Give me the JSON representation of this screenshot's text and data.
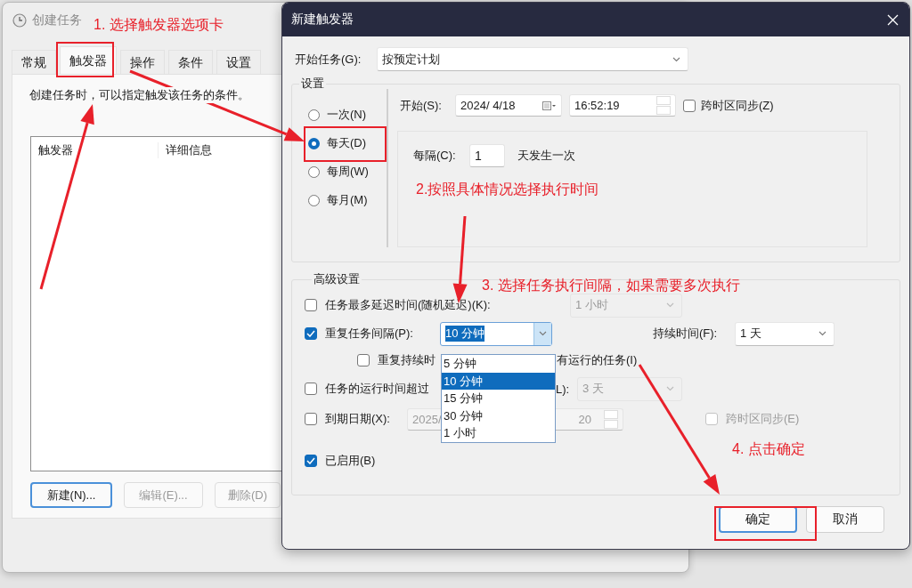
{
  "back_window": {
    "title": "创建任务",
    "tabs": [
      {
        "label": "常规",
        "selected": false
      },
      {
        "label": "触发器",
        "selected": true
      },
      {
        "label": "操作",
        "selected": false
      },
      {
        "label": "条件",
        "selected": false
      },
      {
        "label": "设置",
        "selected": false
      }
    ],
    "description": "创建任务时，可以指定触发该任务的条件。",
    "table": {
      "columns": [
        "触发器",
        "详细信息"
      ]
    },
    "buttons": [
      {
        "label": "新建(N)...",
        "disabled": false
      },
      {
        "label": "编辑(E)...",
        "disabled": true
      },
      {
        "label": "删除(D)",
        "disabled": true
      }
    ]
  },
  "dialog": {
    "title": "新建触发器",
    "begin_task": {
      "label": "开始任务(G):",
      "value": "按预定计划"
    },
    "settings": {
      "title": "设置",
      "schedule_options": [
        {
          "label": "一次(N)",
          "selected": false
        },
        {
          "label": "每天(D)",
          "selected": true
        },
        {
          "label": "每周(W)",
          "selected": false
        },
        {
          "label": "每月(M)",
          "selected": false
        }
      ],
      "start": {
        "label": "开始(S):",
        "date": "2024/  4/18",
        "time": "16:52:19"
      },
      "sync_timezone": {
        "label": "跨时区同步(Z)",
        "checked": false
      },
      "recur": {
        "label": "每隔(C):",
        "value": "1",
        "suffix": "天发生一次"
      }
    },
    "advanced": {
      "title": "高级设置",
      "delay": {
        "label": "任务最多延迟时间(随机延迟)(K):",
        "checked": false,
        "value": "1 小时"
      },
      "repeat": {
        "label": "重复任务间隔(P):",
        "checked": true,
        "value": "10 分钟",
        "duration_label": "持续时间(F):",
        "duration": "1 天",
        "options": [
          {
            "label": "5 分钟",
            "selected": false
          },
          {
            "label": "10 分钟",
            "selected": true
          },
          {
            "label": "15 分钟",
            "selected": false
          },
          {
            "label": "30 分钟",
            "selected": false
          },
          {
            "label": "1 小时",
            "selected": false
          }
        ]
      },
      "stop_at_end": {
        "label_start": "重复持续时",
        "label_end": "有运行的任务(I)",
        "checked": false
      },
      "stop_if_longer": {
        "label_start": "任务的运行时间超过",
        "label_end": "L):",
        "checked": false,
        "value": "3 天"
      },
      "expire": {
        "label": "到期日期(X):",
        "checked": false,
        "date": "2025/",
        "time": "20",
        "sync_label": "跨时区同步(E)",
        "sync_checked": false
      },
      "enabled": {
        "label": "已启用(B)",
        "checked": true
      }
    },
    "buttons": [
      {
        "label": "确定",
        "default": true
      },
      {
        "label": "取消",
        "default": false
      }
    ]
  },
  "annotations": [
    {
      "text": "1. 选择触发器选项卡"
    },
    {
      "text": "2.按照具体情况选择执行时间"
    },
    {
      "text": "3. 选择任务执行间隔，如果需要多次执行"
    },
    {
      "text": "4. 点击确定"
    }
  ]
}
